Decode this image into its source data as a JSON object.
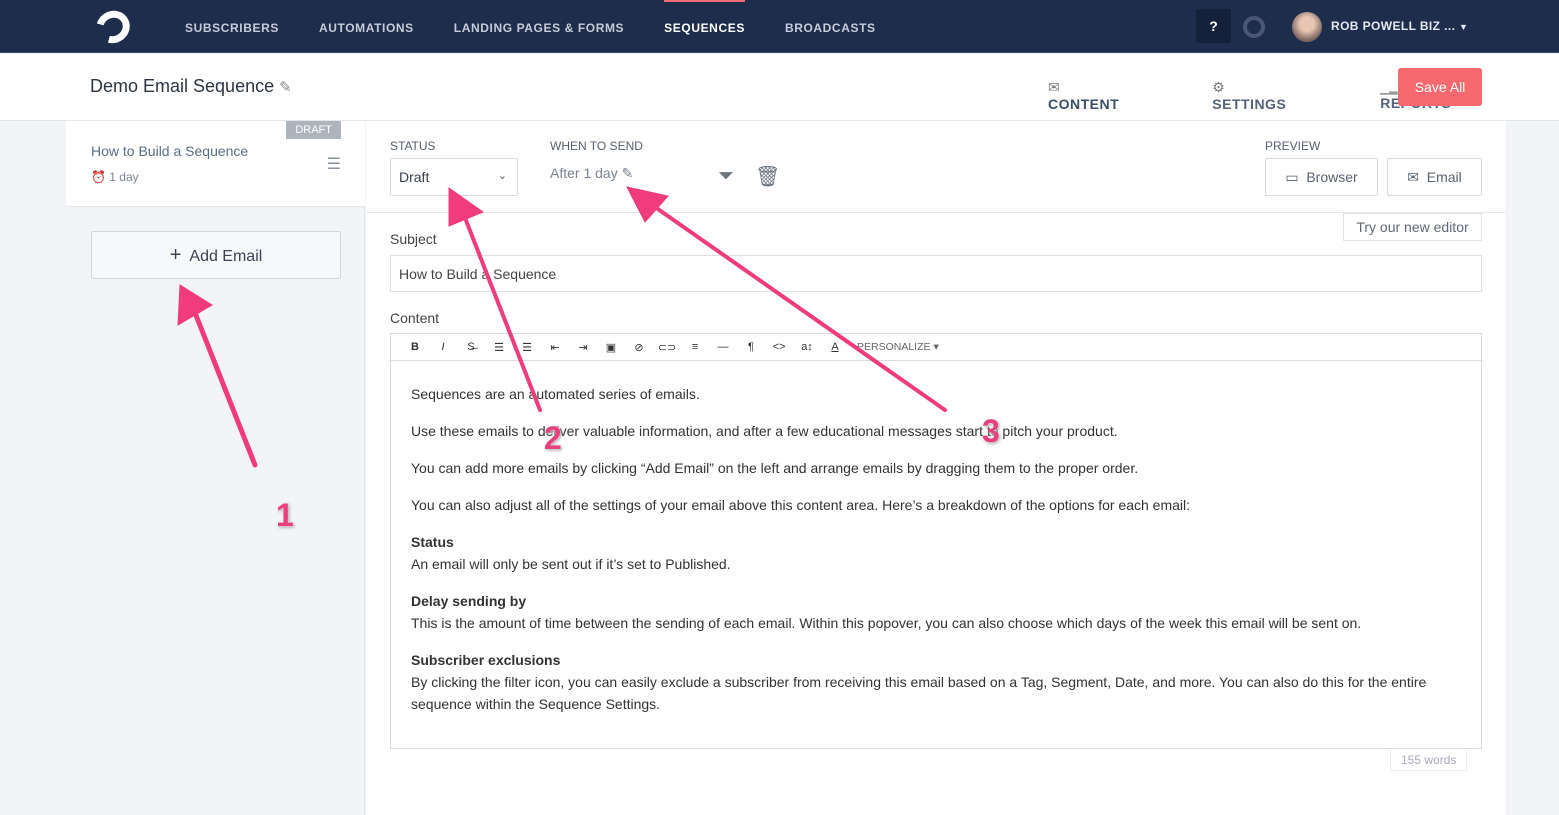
{
  "nav": {
    "items": [
      "SUBSCRIBERS",
      "AUTOMATIONS",
      "LANDING PAGES & FORMS",
      "SEQUENCES",
      "BROADCASTS"
    ],
    "active": "SEQUENCES",
    "help": "?",
    "user": "ROB POWELL BIZ ..."
  },
  "header": {
    "title": "Demo Email Sequence",
    "tabs": [
      "CONTENT",
      "SETTINGS",
      "REPORTS"
    ],
    "save": "Save All"
  },
  "sidebar": {
    "email": {
      "badge": "DRAFT",
      "name": "How to Build a Sequence",
      "delay": "1 day"
    },
    "add": "Add Email"
  },
  "email": {
    "status_label": "STATUS",
    "status": "Draft",
    "when_label": "WHEN TO SEND",
    "when": "After 1 day",
    "preview_label": "PREVIEW",
    "browser": "Browser",
    "email_btn": "Email",
    "try_editor": "Try our new editor",
    "subject_label": "Subject",
    "subject": "How to Build a Sequence",
    "content_label": "Content",
    "personalize": "PERSONALIZE ▾",
    "word_count": "155 words",
    "toolbar": [
      "B",
      "I",
      "S̶",
      "☰",
      "☰",
      "⇤",
      "⇥",
      "▣",
      "⊘",
      "⊂⊃",
      "≡",
      "—",
      "¶",
      "<>",
      "a↕",
      "A"
    ],
    "paragraphs": [
      "Sequences are an automated series of emails.",
      "Use these emails to deliver valuable information, and after a few educational messages start to pitch your product.",
      "You can add more emails by clicking “Add Email” on the left and arrange emails by dragging them to the proper order.",
      "You can also adjust all of the settings of your email above this content area. Here’s a breakdown of the options for each email:"
    ],
    "sections": [
      {
        "h": "Status",
        "t": "An email will only be sent out if it’s set to Published."
      },
      {
        "h": "Delay sending by",
        "t": "This is the amount of time between the sending of each email. Within this popover, you can also choose which days of the week this email will be sent on."
      },
      {
        "h": "Subscriber exclusions",
        "t": "By clicking the filter icon, you can easily exclude a subscriber from receiving this email based on a Tag, Segment, Date, and more. You can also do this for the entire sequence within the Sequence Settings."
      }
    ]
  },
  "annotations": {
    "color": "#f03c7c",
    "labels": [
      "1",
      "2",
      "3"
    ]
  }
}
